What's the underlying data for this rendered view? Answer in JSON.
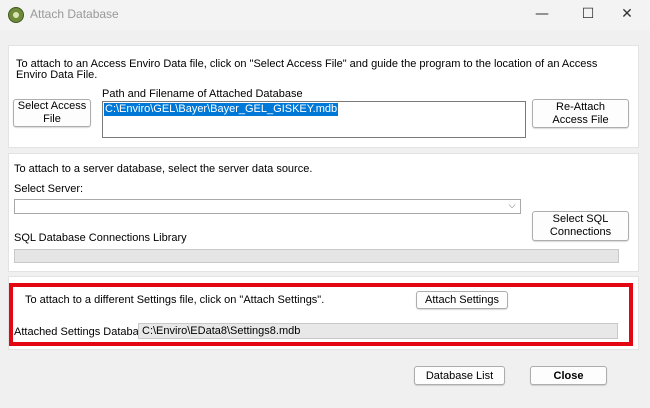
{
  "window": {
    "title": "Attach Database",
    "minimize_glyph": "—",
    "maximize_glyph": "☐",
    "close_glyph": "✕"
  },
  "access_section": {
    "instruction_line1": "To attach to an Access Enviro Data file, click on \"Select Access File\" and guide the program to the location of an Access",
    "instruction_line2": "Enviro Data File.",
    "select_button_line1": "Select Access",
    "select_button_line2": "File",
    "path_label": "Path and Filename of Attached Database",
    "path_value": "C:\\Enviro\\GEL\\Bayer\\Bayer_GEL_GISKEY.mdb",
    "reattach_button_line1": "Re-Attach",
    "reattach_button_line2": "Access File"
  },
  "server_section": {
    "instruction": "To attach to a server database, select the server data source.",
    "select_server_label": "Select Server:",
    "server_value": "",
    "sql_button_line1": "Select SQL",
    "sql_button_line2": "Connections",
    "library_label": "SQL Database Connections Library",
    "library_value": ""
  },
  "settings_section": {
    "instruction": "To attach to a different Settings file, click on \"Attach Settings\".",
    "attach_button": "Attach Settings",
    "attached_label": "Attached Settings Databa",
    "attached_value": "C:\\Enviro\\EData8\\Settings8.mdb",
    "highlight_color": "#e30613"
  },
  "footer": {
    "database_list_button": "Database List",
    "close_button": "Close"
  },
  "icons": {
    "app": "enviro-app-icon",
    "dropdown": "chevron-down-icon"
  }
}
